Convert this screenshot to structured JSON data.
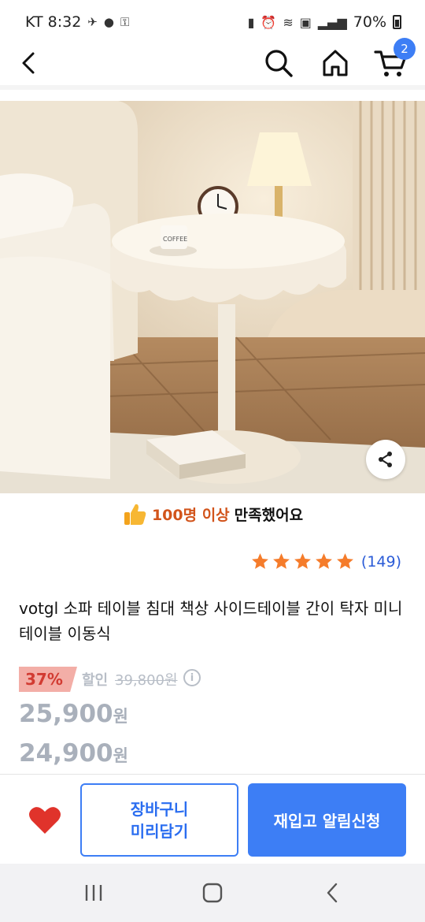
{
  "status_bar": {
    "carrier_time": "KT 8:32",
    "battery": "70%"
  },
  "nav": {
    "cart_count": "2"
  },
  "satisfaction": {
    "highlight": "100명 이상",
    "rest": "만족했어요"
  },
  "rating": {
    "stars": 5,
    "review_count": "(149)"
  },
  "product": {
    "title": "votgl 소파 테이블 침대 책상 사이드테이블 간이 탁자 미니 테이블 이동식",
    "discount_rate": "37%",
    "discount_label": "할인",
    "original_price": "39,800원",
    "price_1": "25,900",
    "price_2": "24,900",
    "currency": "원"
  },
  "actions": {
    "cart_line1": "장바구니",
    "cart_line2": "미리담기",
    "notify": "재입고 알림신청"
  },
  "colors": {
    "accent": "#3d7ef5",
    "discount": "#d23b32",
    "heart": "#e0332b",
    "star": "#f57c2b"
  }
}
